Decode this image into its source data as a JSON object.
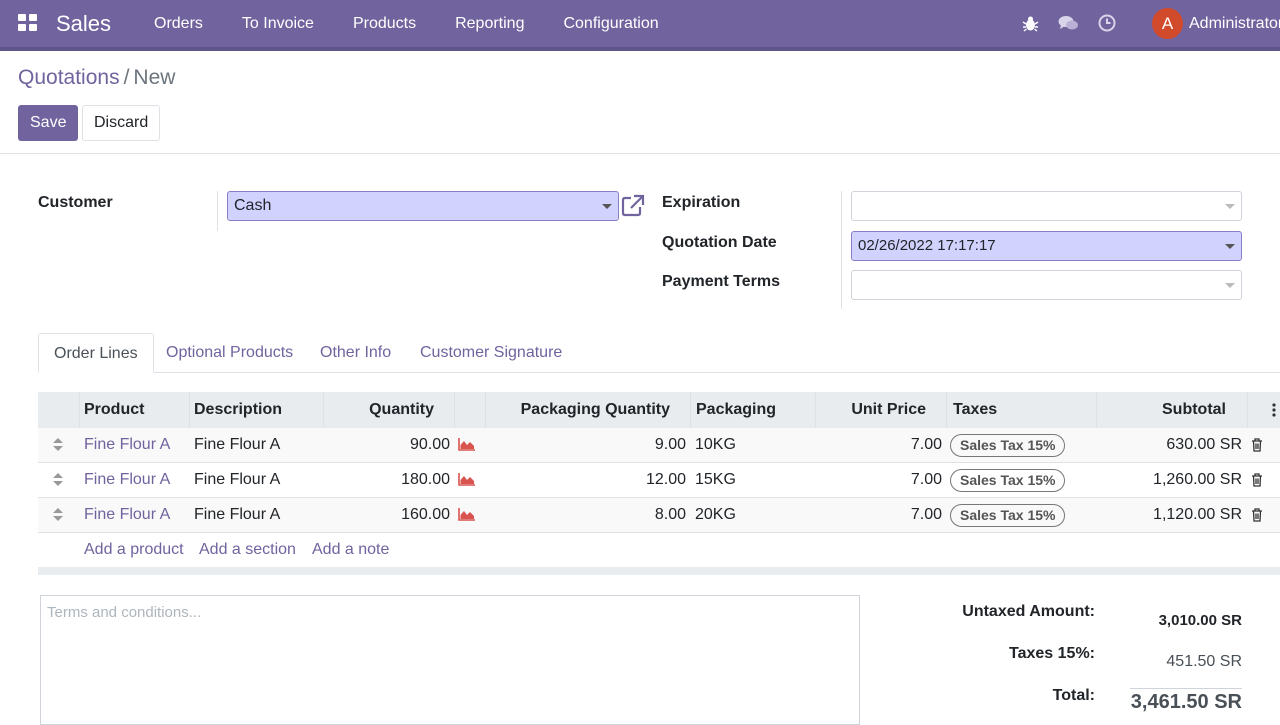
{
  "navbar": {
    "app_name": "Sales",
    "menu": [
      "Orders",
      "To Invoice",
      "Products",
      "Reporting",
      "Configuration"
    ],
    "avatar_letter": "A",
    "username": "Administrator",
    "bar_color": "#71639e"
  },
  "breadcrumb": {
    "parent": "Quotations",
    "separator": "/",
    "current": "New"
  },
  "buttons": {
    "save": "Save",
    "discard": "Discard"
  },
  "form": {
    "customer_label": "Customer",
    "customer_value": "Cash",
    "expiration_label": "Expiration",
    "expiration_value": "",
    "quotation_date_label": "Quotation Date",
    "quotation_date_value": "02/26/2022 17:17:17",
    "payment_terms_label": "Payment Terms",
    "payment_terms_value": ""
  },
  "tabs": [
    "Order Lines",
    "Optional Products",
    "Other Info",
    "Customer Signature"
  ],
  "table": {
    "headers": {
      "product": "Product",
      "description": "Description",
      "quantity": "Quantity",
      "packaging_quantity": "Packaging Quantity",
      "packaging": "Packaging",
      "unit_price": "Unit Price",
      "taxes": "Taxes",
      "subtotal": "Subtotal"
    },
    "rows": [
      {
        "product": "Fine Flour A",
        "description": "Fine Flour A",
        "quantity": "90.00",
        "packaging_quantity": "9.00",
        "packaging": "10KG",
        "unit_price": "7.00",
        "tax": "Sales Tax 15%",
        "subtotal": "630.00 SR"
      },
      {
        "product": "Fine Flour A",
        "description": "Fine Flour A",
        "quantity": "180.00",
        "packaging_quantity": "12.00",
        "packaging": "15KG",
        "unit_price": "7.00",
        "tax": "Sales Tax 15%",
        "subtotal": "1,260.00 SR"
      },
      {
        "product": "Fine Flour A",
        "description": "Fine Flour A",
        "quantity": "160.00",
        "packaging_quantity": "8.00",
        "packaging": "20KG",
        "unit_price": "7.00",
        "tax": "Sales Tax 15%",
        "subtotal": "1,120.00 SR"
      }
    ],
    "add_product": "Add a product",
    "add_section": "Add a section",
    "add_note": "Add a note"
  },
  "terms_placeholder": "Terms and conditions...",
  "totals": {
    "untaxed_label": "Untaxed Amount:",
    "untaxed_value": "3,010.00 SR",
    "taxes_label": "Taxes 15%:",
    "taxes_value": "451.50 SR",
    "total_label": "Total:",
    "total_value": "3,461.50 SR"
  }
}
